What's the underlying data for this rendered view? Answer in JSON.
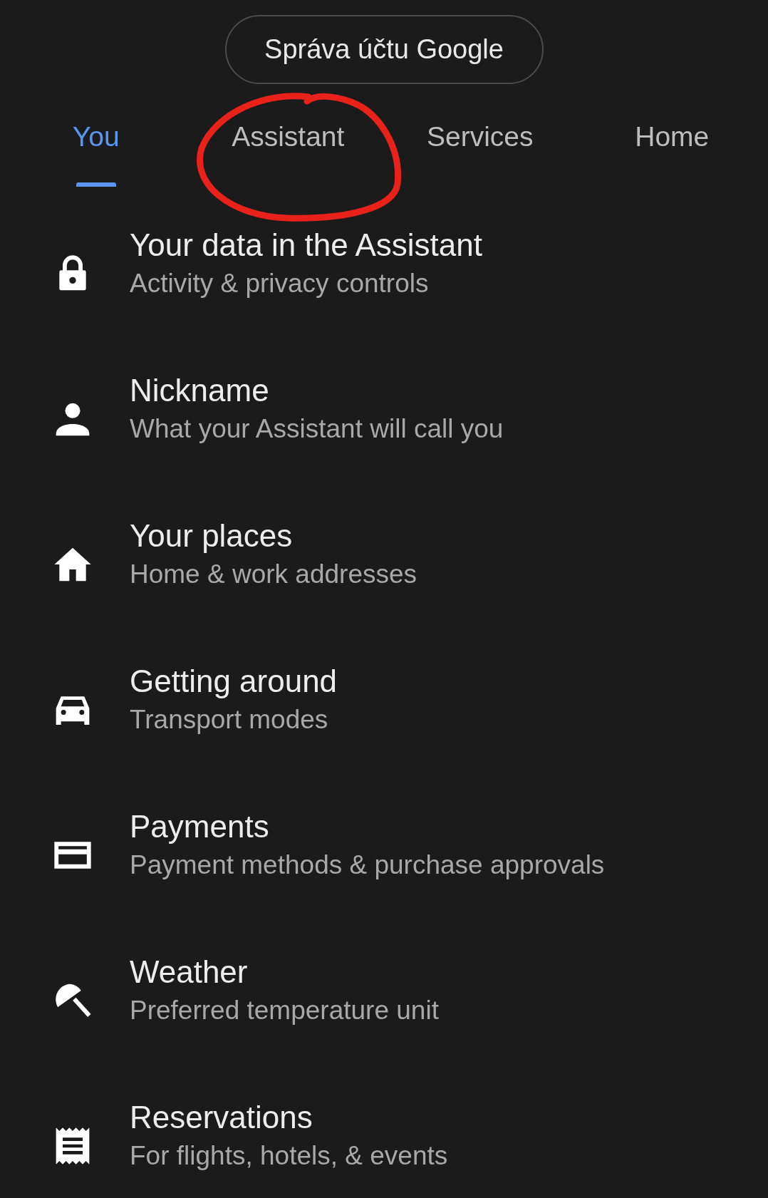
{
  "account_button": {
    "label": "Správa účtu Google"
  },
  "tabs": [
    {
      "label": "You",
      "selected": true
    },
    {
      "label": "Assistant",
      "selected": false
    },
    {
      "label": "Services",
      "selected": false
    },
    {
      "label": "Home",
      "selected": false
    }
  ],
  "items": [
    {
      "title": "Your data in the Assistant",
      "subtitle": "Activity & privacy controls"
    },
    {
      "title": "Nickname",
      "subtitle": "What your Assistant will call you"
    },
    {
      "title": "Your places",
      "subtitle": "Home & work addresses"
    },
    {
      "title": "Getting around",
      "subtitle": "Transport modes"
    },
    {
      "title": "Payments",
      "subtitle": "Payment methods & purchase approvals"
    },
    {
      "title": "Weather",
      "subtitle": "Preferred temperature unit"
    },
    {
      "title": "Reservations",
      "subtitle": "For flights, hotels, & events"
    }
  ]
}
